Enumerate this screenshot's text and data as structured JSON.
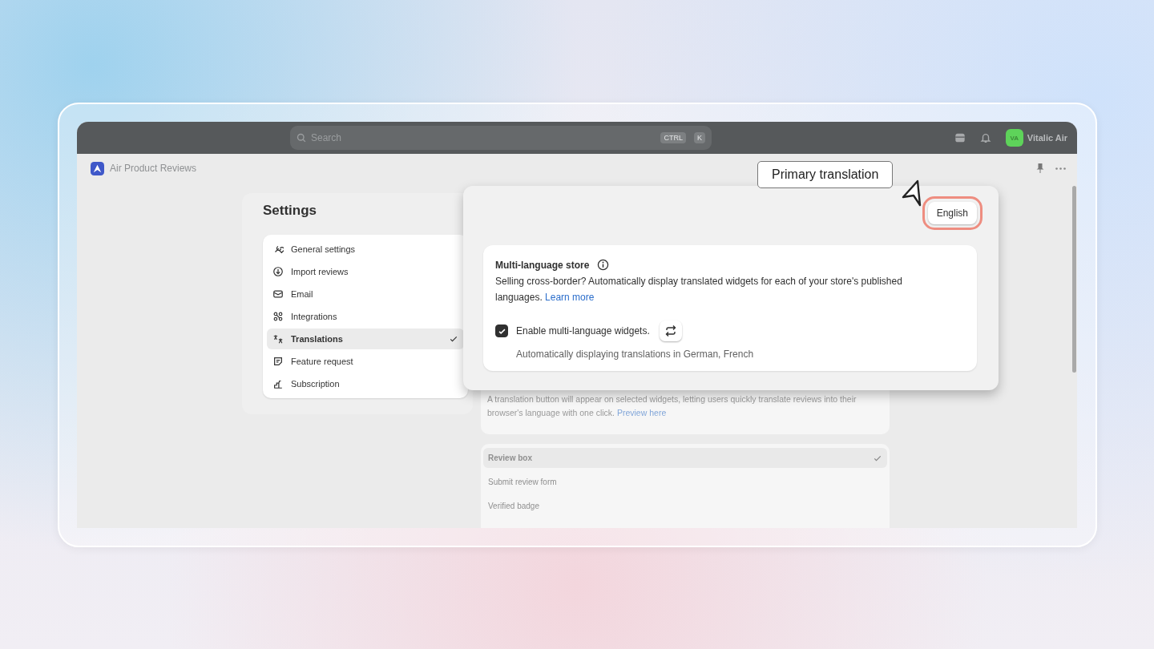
{
  "topbar": {
    "search_placeholder": "Search",
    "shortcut": [
      "CTRL",
      "K"
    ],
    "avatar_initials": "VA",
    "user_name": "Vitalic Air"
  },
  "app": {
    "title": "Air Product Reviews"
  },
  "settings": {
    "title": "Settings",
    "items": [
      {
        "label": "General settings",
        "selected": false
      },
      {
        "label": "Import reviews",
        "selected": false
      },
      {
        "label": "Email",
        "selected": false
      },
      {
        "label": "Integrations",
        "selected": false
      },
      {
        "label": "Translations",
        "selected": true
      },
      {
        "label": "Feature request",
        "selected": false
      },
      {
        "label": "Subscription",
        "selected": false
      }
    ]
  },
  "background_card": {
    "text": "A translation button will appear on selected widgets, letting users quickly translate reviews into their browser's language with one click.",
    "link": "Preview here"
  },
  "widget_list": {
    "items": [
      {
        "label": "Review box",
        "selected": true
      },
      {
        "label": "Submit review form",
        "selected": false
      },
      {
        "label": "Verified badge",
        "selected": false
      }
    ]
  },
  "popover": {
    "language_button": "English",
    "highlighted": true,
    "card": {
      "title": "Multi-language store",
      "description": "Selling cross-border? Automatically display translated widgets for each of your store's published languages.",
      "link": "Learn more",
      "checkbox": {
        "label": "Enable multi-language widgets.",
        "checked": true
      },
      "status": "Automatically displaying translations in German, French"
    }
  },
  "tooltip": {
    "text": "Primary translation"
  }
}
